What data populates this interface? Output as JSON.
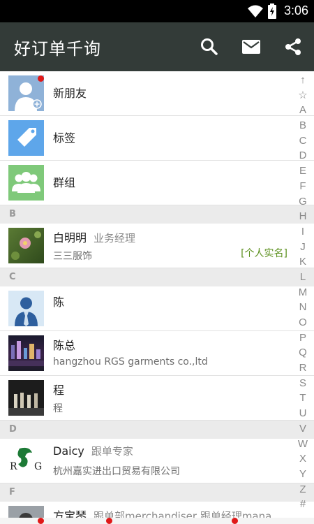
{
  "status_bar": {
    "time": "3:06"
  },
  "app_bar": {
    "title": "好订单千询",
    "icons": [
      "search-icon",
      "mail-icon",
      "share-icon"
    ]
  },
  "top_items": [
    {
      "label": "新朋友",
      "icon": "new-friend-icon",
      "badge": true
    },
    {
      "label": "标签",
      "icon": "tag-icon"
    },
    {
      "label": "群组",
      "icon": "group-icon"
    }
  ],
  "sections": {
    "b": "B",
    "c": "C",
    "d": "D",
    "f": "F"
  },
  "contacts": [
    {
      "name": "白明明",
      "role": "业务经理",
      "company": "三三服饰",
      "tag": "[个人实名]"
    },
    {
      "name": "陈",
      "role": "",
      "company": ""
    },
    {
      "name": "陈总",
      "role": "",
      "company": "hangzhou RGS garments co.,ltd"
    },
    {
      "name": "程",
      "role": "",
      "company": "程"
    },
    {
      "name": "Daicy",
      "role": "跟单专家",
      "company": "杭州嘉实进出口贸易有限公司"
    },
    {
      "name": "方宝琴",
      "role": "跟单部merchandiser 跟单经理mana",
      "company": ""
    }
  ],
  "index_letters": [
    "↑",
    "☆",
    "A",
    "B",
    "C",
    "D",
    "E",
    "F",
    "G",
    "H",
    "I",
    "J",
    "K",
    "L",
    "M",
    "N",
    "O",
    "P",
    "Q",
    "R",
    "S",
    "T",
    "U",
    "V",
    "W",
    "X",
    "Y",
    "Z",
    "#"
  ],
  "colors": {
    "app_bar": "#333b38",
    "tag_green": "#5a8f1b",
    "badge_red": "#e01818"
  }
}
